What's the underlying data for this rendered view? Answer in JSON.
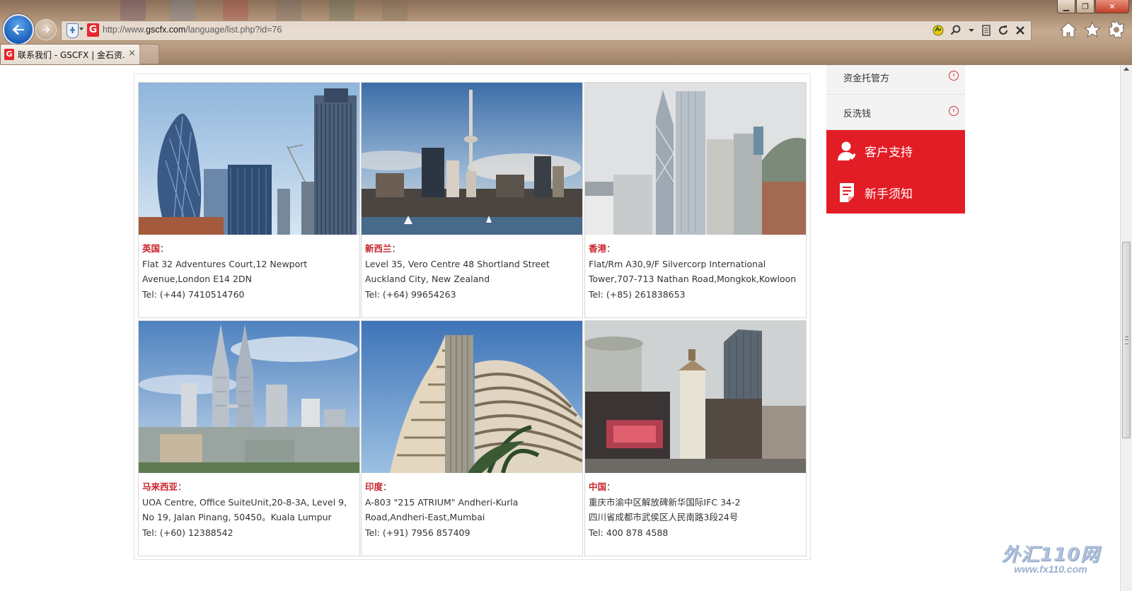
{
  "browser": {
    "url_prefix": "http://www.",
    "url_domain": "gscfx.com",
    "url_path": "/language/list.php?id=76",
    "tab_title": "联系我们 - GSCFX | 金石资...",
    "tab_close": "×",
    "window_controls": {
      "min": "▁",
      "max": "❐",
      "close": "✕"
    },
    "site_logo_letter": "G"
  },
  "sidebar": {
    "links": [
      {
        "label": "资金托管方",
        "icon": "circle-chevron-right-icon"
      },
      {
        "label": "反洗钱",
        "icon": "circle-chevron-right-icon"
      }
    ],
    "red_items": [
      {
        "label": "客户支持",
        "icon": "customer-support-icon"
      },
      {
        "label": "新手须知",
        "icon": "document-icon"
      }
    ]
  },
  "offices": [
    {
      "country": "英国",
      "colon": "：",
      "lines": [
        "Flat 32 Adventures Court,12 Newport",
        "Avenue,London E14 2DN",
        "Tel: (+44) 7410514760"
      ],
      "photo": "london-skyline-photo"
    },
    {
      "country": "新西兰",
      "colon": "：",
      "lines": [
        "Level 35, Vero Centre 48 Shortland Street",
        "Auckland City, New Zealand",
        "Tel: (+64) 99654263"
      ],
      "photo": "auckland-skyline-photo"
    },
    {
      "country": "香港",
      "colon": "：",
      "lines": [
        "Flat/Rm A30,9/F Silvercorp International",
        "Tower,707-713 Nathan Road,Mongkok,Kowloon",
        "Tel: (+85) 261838653"
      ],
      "photo": "hongkong-skyline-photo"
    },
    {
      "country": "马来西亚",
      "colon": "：",
      "lines": [
        "UOA Centre, Office SuiteUnit,20-8-3A, Level 9,",
        "No 19, Jalan Pinang, 50450。Kuala Lumpur",
        "Tel: (+60) 12388542"
      ],
      "photo": "kualalumpur-skyline-photo"
    },
    {
      "country": "印度",
      "colon": "：",
      "lines": [
        "A-803 \"215 ATRIUM\" Andheri-Kurla",
        "Road,Andheri-East,Mumbai",
        "Tel: (+91) 7956 857409"
      ],
      "photo": "mumbai-building-photo"
    },
    {
      "country": "中国",
      "colon": "：",
      "lines": [
        "重庆市渝中区解放碑新华国际IFC 34-2",
        "四川省成都市武侯区人民南路3段24号",
        "Tel: 400 878 4588"
      ],
      "photo": "chongqing-street-photo"
    }
  ],
  "watermark": {
    "main": "外汇110网",
    "url": "www.fx110.com"
  },
  "colors": {
    "accent_red": "#e31d25",
    "country_red": "#c8252b"
  }
}
